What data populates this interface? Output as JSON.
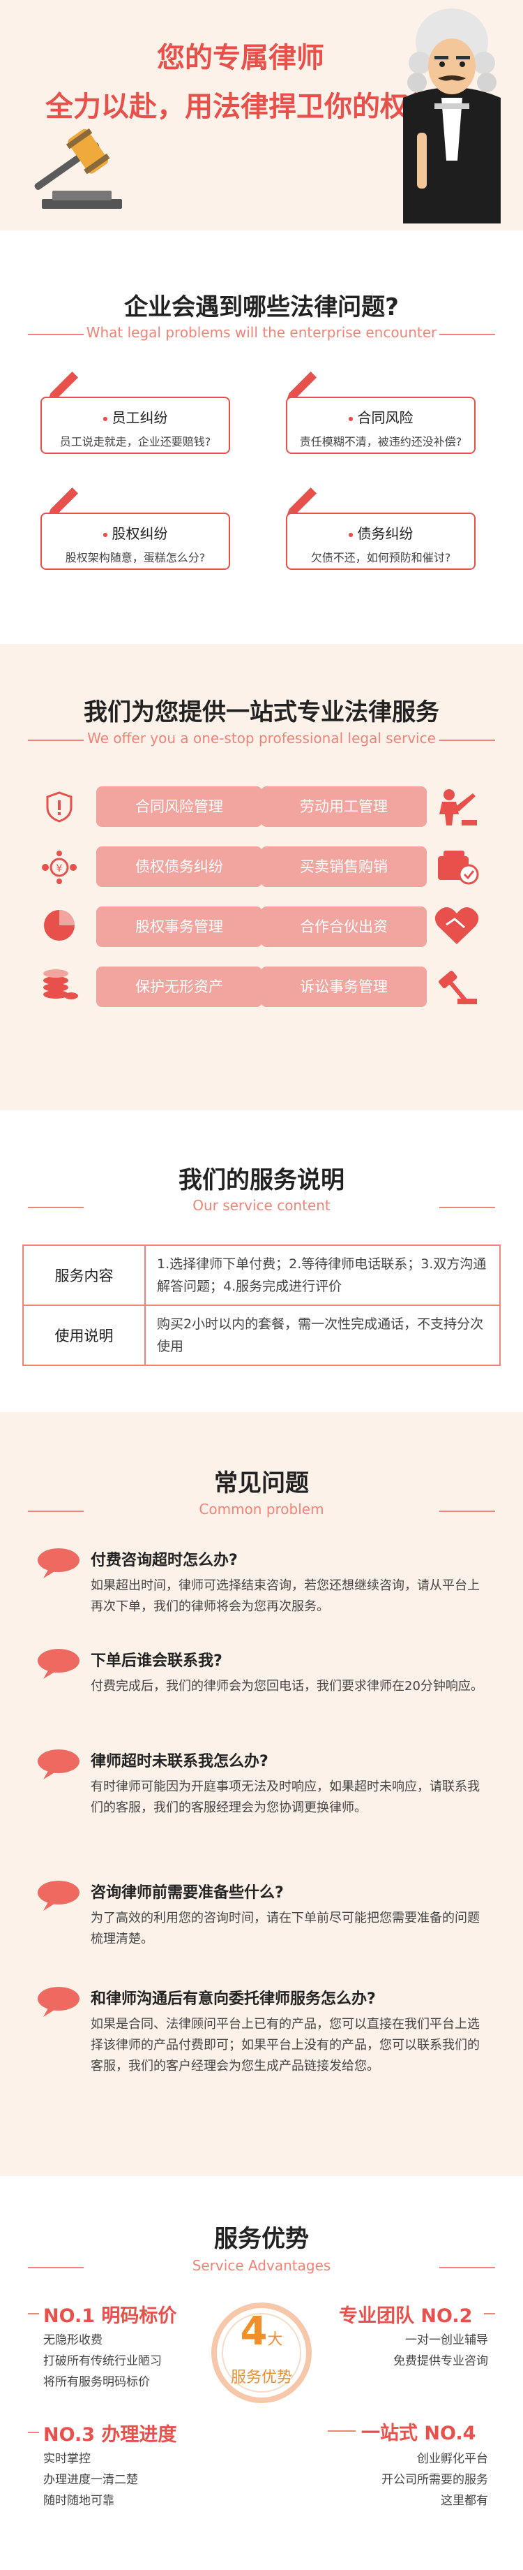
{
  "hero": {
    "line1": "您的专属律师",
    "line2": "全力以赴，用法律捍卫你的权益"
  },
  "problems": {
    "title": "企业会遇到哪些法律问题?",
    "subtitle": "What legal problems will the enterprise encounter",
    "items": [
      {
        "title": "员工纠纷",
        "desc": "员工说走就走，企业还要赔钱?"
      },
      {
        "title": "合同风险",
        "desc": "责任模糊不清，被违约还没补偿?"
      },
      {
        "title": "股权纠纷",
        "desc": "股权架构随意，蛋糕怎么分?"
      },
      {
        "title": "债务纠纷",
        "desc": "欠债不还，如何预防和催讨?"
      }
    ]
  },
  "services": {
    "title": "我们为您提供一站式专业法律服务",
    "subtitle": "We offer you a one-stop professional legal service",
    "left": [
      "合同风险管理",
      "债权债务纠纷",
      "股权事务管理",
      "保护无形资产"
    ],
    "right": [
      "劳动用工管理",
      "买卖销售购销",
      "合作合伙出资",
      "诉讼事务管理"
    ]
  },
  "service_content": {
    "title": "我们的服务说明",
    "subtitle": "Our service content",
    "rows": [
      {
        "label": "服务内容",
        "text": "1.选择律师下单付费；2.等待律师电话联系；3.双方沟通解答问题；4.服务完成进行评价"
      },
      {
        "label": "使用说明",
        "text": "购买2小时以内的套餐，需一次性完成通话，不支持分次使用"
      }
    ]
  },
  "faq": {
    "title": "常见问题",
    "subtitle": "Common problem",
    "items": [
      {
        "q": "付费咨询超时怎么办?",
        "a": "如果超出时间，律师可选择结束咨询，若您还想继续咨询，请从平台上再次下单，我们的律师将会为您再次服务。"
      },
      {
        "q": "下单后谁会联系我?",
        "a": "付费完成后，我们的律师会为您回电话，我们要求律师在20分钟响应。"
      },
      {
        "q": "律师超时未联系我怎么办?",
        "a": "有时律师可能因为开庭事项无法及时响应，如果超时未响应，请联系我们的客服，我们的客服经理会为您协调更换律师。"
      },
      {
        "q": "咨询律师前需要准备些什么?",
        "a": "为了高效的利用您的咨询时间，请在下单前尽可能把您需要准备的问题梳理清楚。"
      },
      {
        "q": "和律师沟通后有意向委托律师服务怎么办?",
        "a": "如果是合同、法律顾问平台上已有的产品，您可以直接在我们平台上选择该律师的产品付费即可；如果平台上没有的产品，您可以联系我们的客服，我们的客户经理会为您生成产品链接发给您。"
      }
    ]
  },
  "advantages": {
    "title": "服务优势",
    "subtitle": "Service Advantages",
    "center_num": "4",
    "center_unit": "大",
    "center_label": "服务优势",
    "items": [
      {
        "head": "NO.1 明码标价",
        "lines": [
          "无隐形收费",
          "打破所有传统行业陋习",
          "将所有服务明码标价"
        ]
      },
      {
        "head": "专业团队 NO.2",
        "lines": [
          "一对一创业辅导",
          "免费提供专业咨询"
        ]
      },
      {
        "head": "NO.3 办理进度",
        "lines": [
          "实时掌控",
          "办理进度一清二楚",
          "随时随地可靠"
        ]
      },
      {
        "head": "一站式 NO.4",
        "lines": [
          "创业孵化平台",
          "开公司所需要的服务",
          "这里都有"
        ]
      }
    ]
  }
}
